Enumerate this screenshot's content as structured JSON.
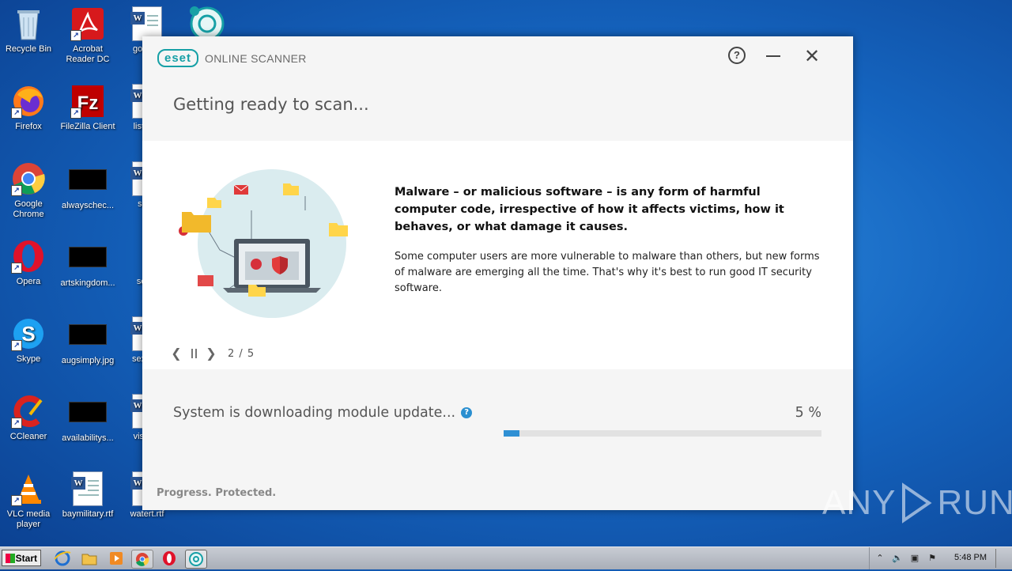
{
  "desktop": {
    "icons": [
      {
        "label": "Recycle Bin"
      },
      {
        "label": "Acrobat Reader DC"
      },
      {
        "label": "gover..."
      },
      {
        "label": "Firefox"
      },
      {
        "label": "FileZilla Client"
      },
      {
        "label": "listen..."
      },
      {
        "label": "Google Chrome"
      },
      {
        "label": "alwayschec..."
      },
      {
        "label": "sat..."
      },
      {
        "label": "Opera"
      },
      {
        "label": "artskingdom..."
      },
      {
        "label": "self..."
      },
      {
        "label": "Skype"
      },
      {
        "label": "augsimply.jpg"
      },
      {
        "label": "sexyg..."
      },
      {
        "label": "CCleaner"
      },
      {
        "label": "availabilitys..."
      },
      {
        "label": "visua..."
      },
      {
        "label": "VLC media player"
      },
      {
        "label": "baymilitary.rtf"
      },
      {
        "label": "watert.rtf"
      }
    ]
  },
  "window": {
    "brand": "eset",
    "product": "ONLINE SCANNER",
    "heading": "Getting ready to scan...",
    "headline": "Malware – or malicious software – is any form of harmful computer code, irrespective of how it affects victims, how it behaves, or what damage it causes.",
    "body": "Some computer users are more vulnerable to malware than others, but new forms of malware are emerging all the time. That's why it's best to run good IT security software.",
    "pager": {
      "count": "2 / 5"
    },
    "status": "System is downloading module update...",
    "percent_text": "5 %",
    "progress": 0.05,
    "footer": "Progress. Protected."
  },
  "watermark": {
    "left": "ANY",
    "right": "RUN"
  },
  "taskbar": {
    "start_label": "Start",
    "clock": "5:48 PM"
  },
  "colors": {
    "accent": "#16a0a6",
    "progress": "#2f90d4",
    "desktop": "#1565c0"
  }
}
